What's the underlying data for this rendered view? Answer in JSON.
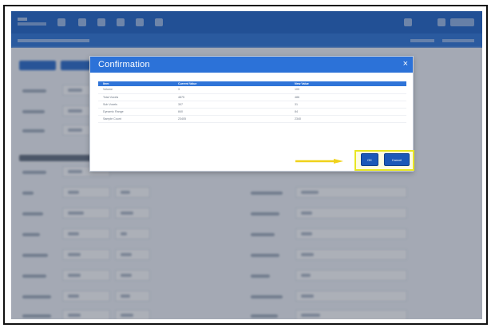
{
  "modal": {
    "title": "Confirmation",
    "close_glyph": "×",
    "table": {
      "headers": [
        "Item",
        "Current Value",
        "New Value"
      ],
      "rows": [
        [
          "Volume",
          "3",
          "100"
        ],
        [
          "Total Voxels",
          "4875",
          "486"
        ],
        [
          "Sub Voxels",
          "307",
          "31"
        ],
        [
          "Dynamic Range",
          "840",
          "84"
        ],
        [
          "Sample Count",
          "23405",
          "2340"
        ]
      ]
    },
    "ok_label": "OK",
    "cancel_label": "Cancel"
  },
  "colors": {
    "header_blue": "#1f63c6",
    "modal_header": "#2c72d8",
    "button": "#1b58b8",
    "highlight": "#e8e622",
    "arrow": "#f0d21a"
  },
  "icons": {
    "topbar": [
      "home-icon",
      "settings-icon",
      "edit-icon",
      "history-icon",
      "grid-icon",
      "tools-icon",
      "user-icon",
      "help-icon",
      "logout-icon"
    ]
  }
}
